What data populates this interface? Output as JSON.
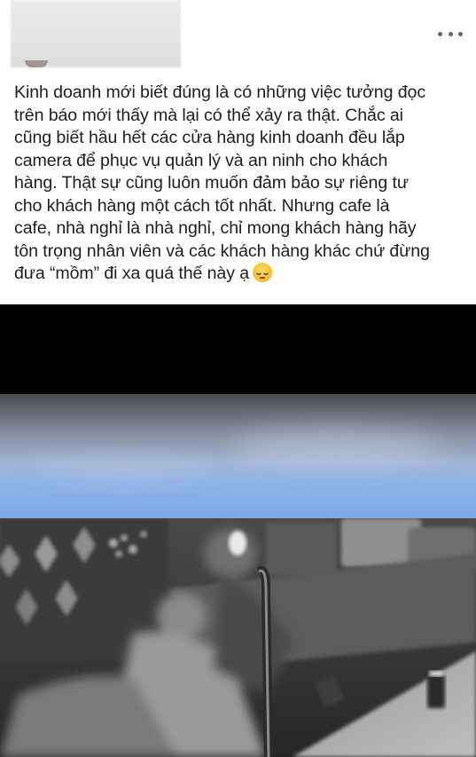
{
  "post": {
    "author_name": "",
    "more_menu_icon": "ellipsis-icon",
    "text_lines": [
      "Kinh doanh mới biết đúng là có những việc tưởng đọc",
      "trên báo mới thấy mà lại có thể xảy ra thật. Chắc ai",
      "cũng biết hầu hết các cửa hàng kinh doanh đều lắp",
      "camera để phục vụ quản lý và an ninh cho khách",
      "hàng. Thật sự cũng luôn muốn đảm bảo sự riêng tư",
      "cho khách hàng một cách tốt nhất. Nhưng cafe là",
      "cafe, nhà nghỉ là nhà nghỉ, chỉ mong khách hàng hãy",
      "tôn trọng nhân viên và các khách hàng khác chứ đừng",
      "đưa “mồm” đi xa quá thế này ạ"
    ],
    "emoji_icon": "pensive-face-emoji-icon"
  },
  "media": {
    "cctv_image_icon": "cctv-photo-image"
  }
}
